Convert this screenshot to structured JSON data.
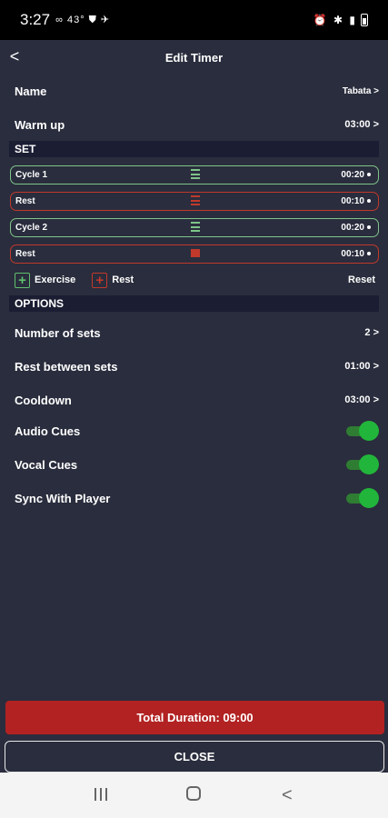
{
  "status_bar": {
    "time": "3:27",
    "left_icons": "∞ 43° ⛊ ✈",
    "right_icons": "⏰ ✱ ▮"
  },
  "header": {
    "back_label": "<",
    "title": "Edit Timer"
  },
  "settings": {
    "name": {
      "label": "Name",
      "value": "Tabata >"
    },
    "warmup": {
      "label": "Warm up",
      "value": "03:00 >"
    }
  },
  "set_section": {
    "title": "SET"
  },
  "set_items": [
    {
      "label": "Cycle 1",
      "duration": "00:20",
      "kind": "cycle"
    },
    {
      "label": "Rest",
      "duration": "00:10",
      "kind": "rest"
    },
    {
      "label": "Cycle 2",
      "duration": "00:20",
      "kind": "cycle"
    },
    {
      "label": "Rest",
      "duration": "00:10",
      "kind": "rest"
    }
  ],
  "add_row": {
    "exercise_label": "Exercise",
    "rest_label": "Rest",
    "reset_label": "Reset",
    "plus": "+"
  },
  "options_section": {
    "title": "OPTIONS"
  },
  "options": {
    "sets": {
      "label": "Number of sets",
      "value": "2 >"
    },
    "rest_between": {
      "label": "Rest between sets",
      "value": "01:00 >"
    },
    "cooldown": {
      "label": "Cooldown",
      "value": "03:00 >"
    },
    "audio": {
      "label": "Audio Cues",
      "on": true
    },
    "vocal": {
      "label": "Vocal Cues",
      "on": true
    },
    "sync": {
      "label": "Sync With Player",
      "on": true
    }
  },
  "footer": {
    "total": "Total Duration: 09:00",
    "close": "CLOSE"
  },
  "colors": {
    "background": "#2a2d3d",
    "cycle": "#7fc48a",
    "rest": "#c0392b",
    "toggle_on": "#22b53b",
    "total_bg": "#b22222"
  },
  "nav": {
    "back": "<"
  }
}
